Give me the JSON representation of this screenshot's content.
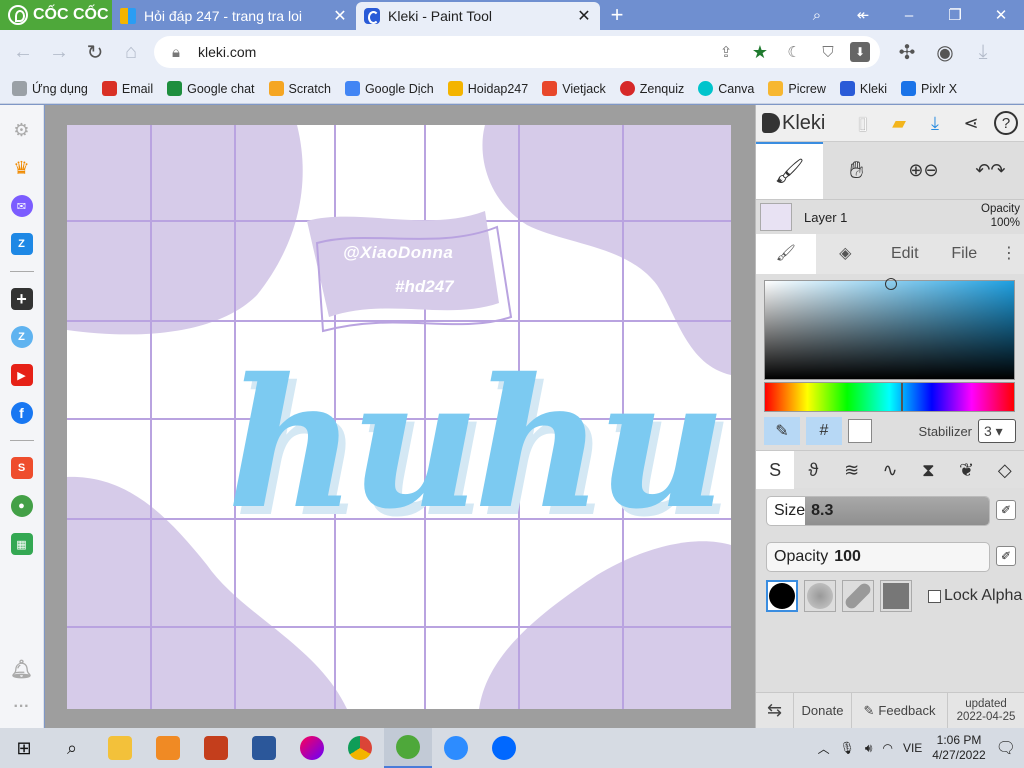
{
  "browser": {
    "brand_name": "CỐC CỐC",
    "tabs": [
      {
        "title": "Hỏi đáp 247 - trang tra loi",
        "icon": "hoidap-favicon"
      },
      {
        "title": "Kleki - Paint Tool",
        "icon": "kleki-favicon"
      }
    ],
    "url": "kleki.com",
    "bookmarks": [
      {
        "label": "Ứng dụng",
        "color": "#7a7a7a"
      },
      {
        "label": "Email",
        "color": "#d93025"
      },
      {
        "label": "Google chat",
        "color": "#1e8e3e"
      },
      {
        "label": "Scratch",
        "color": "#f5a623"
      },
      {
        "label": "Google Dịch",
        "color": "#4285f4"
      },
      {
        "label": "Hoidap247",
        "color": "#f4b400"
      },
      {
        "label": "Vietjack",
        "color": "#e8472b"
      },
      {
        "label": "Zenquiz",
        "color": "#d62828"
      },
      {
        "label": "Canva",
        "color": "#00c4cc"
      },
      {
        "label": "Picrew",
        "color": "#f7b731"
      },
      {
        "label": "Kleki",
        "color": "#2a5bd7"
      },
      {
        "label": "Pixlr X",
        "color": "#1a73e8"
      }
    ]
  },
  "canvas": {
    "watermark_line1": "@XiaoDonna",
    "watermark_line2": "#hd247",
    "main_word": "huhu",
    "blob_color": "#d6cbe9",
    "grid_color": "#b9a3e0",
    "text_color": "#7ccaf1"
  },
  "kleki": {
    "logo_text": "Kleki",
    "layer_name": "Layer 1",
    "layer_opacity_label": "Opacity",
    "layer_opacity_value": "100%",
    "tabs": [
      "Edit",
      "File"
    ],
    "hex_button": "#",
    "stabilizer_label": "Stabilizer",
    "stabilizer_value": "3",
    "size_label": "Size",
    "size_value": "8.3",
    "opacity_label": "Opacity",
    "opacity_value": "100",
    "lock_alpha_label": "Lock Alpha",
    "footer": {
      "donate": "Donate",
      "feedback": "Feedback",
      "updated_label": "updated",
      "updated_date": "2022-04-25"
    }
  },
  "taskbar": {
    "language": "VIE",
    "time": "1:06 PM",
    "date": "4/27/2022"
  }
}
